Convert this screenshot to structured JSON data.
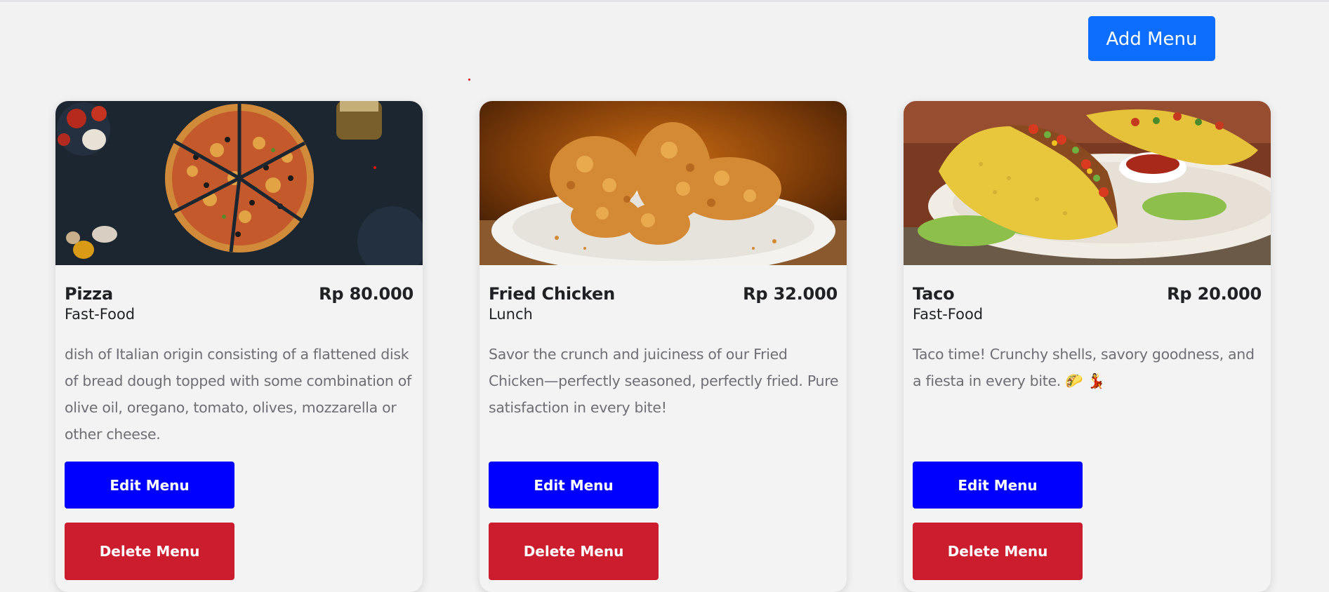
{
  "toolbar": {
    "add_label": "Add Menu"
  },
  "menu_items": [
    {
      "name": "Pizza",
      "price": "Rp 80.000",
      "category": "Fast-Food",
      "description": "dish of Italian origin consisting of a flattened disk of bread dough topped with some combination of olive oil, oregano, tomato, olives, mozzarella or other cheese.",
      "image": "pizza",
      "edit_label": "Edit Menu",
      "delete_label": "Delete Menu"
    },
    {
      "name": "Fried Chicken",
      "price": "Rp 32.000",
      "category": "Lunch",
      "description": "Savor the crunch and juiciness of our Fried Chicken—perfectly seasoned, perfectly fried. Pure satisfaction in every bite!",
      "image": "fried-chicken",
      "edit_label": "Edit Menu",
      "delete_label": "Delete Menu"
    },
    {
      "name": "Taco",
      "price": "Rp 20.000",
      "category": "Fast-Food",
      "description": "Taco time! Crunchy shells, savory goodness, and a fiesta in every bite. 🌮 💃",
      "image": "taco",
      "edit_label": "Edit Menu",
      "delete_label": "Delete Menu"
    }
  ],
  "colors": {
    "primary": "#0d6efd",
    "edit": "#0000ff",
    "delete": "#cb1d2d",
    "background": "#f2f2f3"
  }
}
